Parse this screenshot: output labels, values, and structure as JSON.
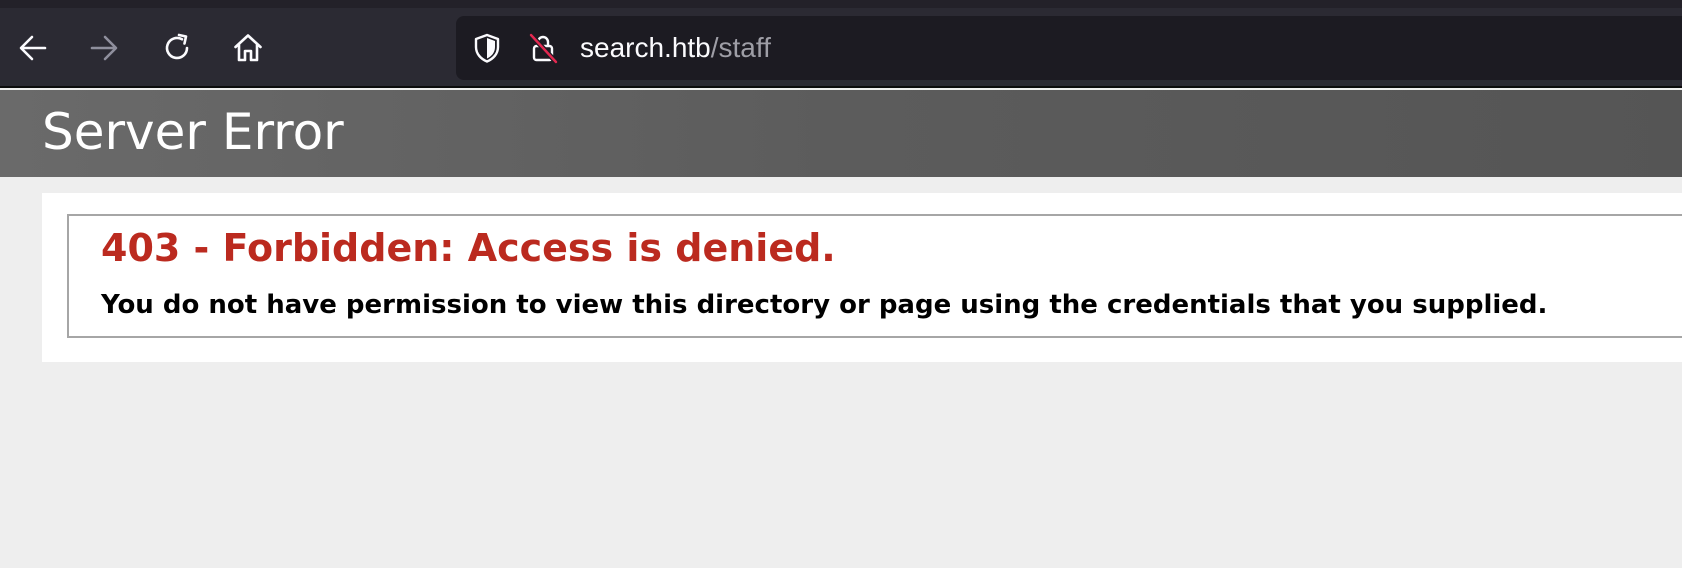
{
  "browser": {
    "toolbar": {
      "back_icon": "arrow-left-icon",
      "forward_icon": "arrow-right-icon",
      "reload_icon": "reload-icon",
      "home_icon": "home-icon"
    },
    "urlbar": {
      "shield_icon": "shield-icon",
      "lock_icon": "insecure-lock-icon",
      "host": "search.htb",
      "path": "/staff"
    },
    "colors": {
      "toolbar_bg": "#2b2a33",
      "urlbar_bg": "#1c1b22",
      "insecure_slash": "#e22850"
    }
  },
  "page": {
    "title": "Server Error",
    "error": {
      "heading": "403 - Forbidden: Access is denied.",
      "message": "You do not have permission to view this directory or page using the credentials that you supplied."
    },
    "colors": {
      "header_bg": "#5c5c5c",
      "error_red": "#bb2a1f",
      "page_bg": "#eeeeee"
    }
  }
}
